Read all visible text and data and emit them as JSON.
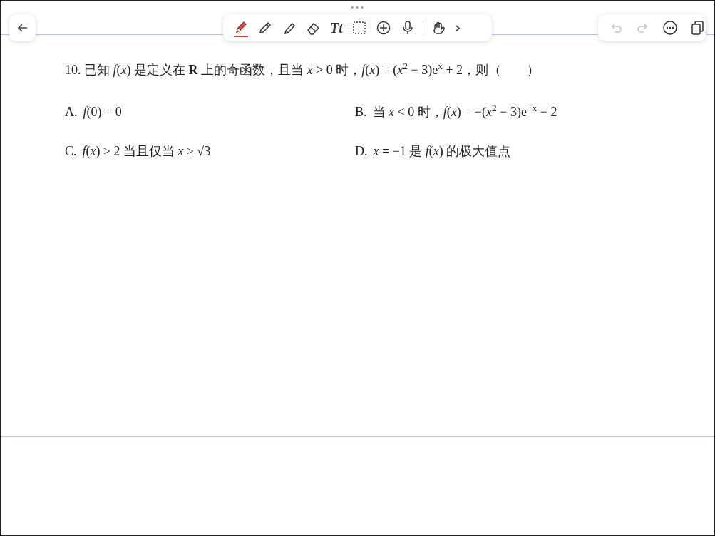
{
  "toolbar": {
    "handle": "•••",
    "tools": [
      {
        "kind": "pen",
        "selected": true
      },
      {
        "kind": "pencil",
        "selected": false
      },
      {
        "kind": "highlighter",
        "selected": false
      },
      {
        "kind": "eraser",
        "selected": false
      },
      {
        "kind": "text",
        "label": "Tt",
        "selected": false
      },
      {
        "kind": "lasso",
        "selected": false
      },
      {
        "kind": "add",
        "selected": false
      },
      {
        "kind": "mic",
        "selected": false
      },
      {
        "kind": "hand",
        "selected": false
      },
      {
        "kind": "more",
        "label": "›",
        "selected": false
      }
    ]
  },
  "right_tools": [
    {
      "kind": "undo",
      "disabled": true
    },
    {
      "kind": "redo",
      "disabled": true
    },
    {
      "kind": "menu",
      "disabled": false
    },
    {
      "kind": "pages",
      "disabled": false
    }
  ],
  "question": "10. 已知 *f*(*x*) 是定义在 **R** 上的奇函数，且当 *x* > 0 时，*f*(*x*) = (*x*$^{2}$ − 3)e$^{x}$ + 2，则（　　）",
  "options": [
    {
      "label": "A.",
      "text": "*f*(0) = 0"
    },
    {
      "label": "B.",
      "text": "当 *x* < 0 时，*f*(*x*) = −(*x*$^{2}$ − 3)e$^{−x}$ − 2"
    },
    {
      "label": "C.",
      "text": "*f*(*x*) ≥ 2 当且仅当 *x* ≥ √3"
    },
    {
      "label": "D.",
      "text": "*x* = −1 是 *f*(*x*) 的极大值点"
    }
  ]
}
